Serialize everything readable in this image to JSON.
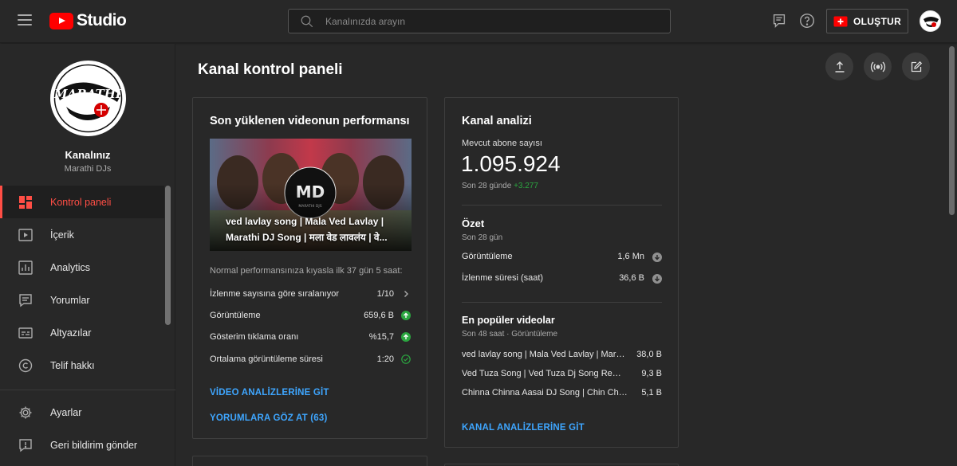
{
  "app": {
    "logo_text": "Studio"
  },
  "search": {
    "placeholder": "Kanalınızda arayın"
  },
  "header": {
    "create_label": "OLUŞTUR"
  },
  "channel": {
    "title": "Kanalınız",
    "name": "Marathi DJs",
    "logo_text": "MARATHI"
  },
  "sidebar": {
    "items": [
      {
        "label": "Kontrol paneli",
        "icon": "dashboard-icon",
        "active": true
      },
      {
        "label": "İçerik",
        "icon": "content-icon"
      },
      {
        "label": "Analytics",
        "icon": "analytics-icon"
      },
      {
        "label": "Yorumlar",
        "icon": "comments-icon"
      },
      {
        "label": "Altyazılar",
        "icon": "subtitles-icon"
      },
      {
        "label": "Telif hakkı",
        "icon": "copyright-icon"
      }
    ],
    "bottom_items": [
      {
        "label": "Ayarlar",
        "icon": "gear-icon"
      },
      {
        "label": "Geri bildirim gönder",
        "icon": "feedback-icon"
      }
    ]
  },
  "page": {
    "title": "Kanal kontrol paneli"
  },
  "latest_video": {
    "card_title": "Son yüklenen videonun performansı",
    "video_title": "ved lavlay song | Mala Ved Lavlay | Marathi DJ Song | मला वेड लावलंय | वे...",
    "thumb_badge": "MD",
    "thumb_badge_sub": "MARATHI DJS",
    "intro": "Normal performansınıza kıyasla ilk 37 gün 5 saat:",
    "metrics": [
      {
        "label": "İzlenme sayısına göre sıralanıyor",
        "value": "1/10",
        "indicator": "chevron-right-icon"
      },
      {
        "label": "Görüntüleme",
        "value": "659,6 B",
        "indicator": "arrow-up-icon"
      },
      {
        "label": "Gösterim tıklama oranı",
        "value": "%15,7",
        "indicator": "arrow-up-icon"
      },
      {
        "label": "Ortalama görüntüleme süresi",
        "value": "1:20",
        "indicator": "check-circle-icon"
      }
    ],
    "link_analytics": "VİDEO ANALİZLERİNE GİT",
    "link_comments": "YORUMLARA GÖZ AT (63)"
  },
  "channel_analytics": {
    "card_title": "Kanal analizi",
    "subs_label": "Mevcut abone sayısı",
    "subs_value": "1.095.924",
    "subs_period": "Son 28 günde",
    "subs_delta": "+3.277",
    "summary_title": "Özet",
    "summary_period": "Son 28 gün",
    "summary_rows": [
      {
        "label": "Görüntüleme",
        "value": "1,6 Mn",
        "indicator": "arrow-down-icon"
      },
      {
        "label": "İzlenme süresi (saat)",
        "value": "36,6 B",
        "indicator": "arrow-down-icon"
      }
    ],
    "top_title": "En popüler videolar",
    "top_period": "Son 48 saat · Görüntüleme",
    "top_videos": [
      {
        "title": "ved lavlay song | Mala Ved Lavlay | Marathi DJ Song",
        "views": "38,0 B"
      },
      {
        "title": "Ved Tuza Song | Ved Tuza Dj Song Remix | Marathi DJ",
        "views": "9,3 B"
      },
      {
        "title": "Chinna Chinna Aasai DJ Song | Chin Chin Remix",
        "views": "5,1 B"
      }
    ],
    "link": "KANAL ANALİZLERİNE GİT"
  },
  "colors": {
    "accent": "#ff4e45",
    "link": "#3ea6ff",
    "positive": "#2ba640",
    "background": "#282828",
    "sidebar_active": "#1f1f1f"
  }
}
